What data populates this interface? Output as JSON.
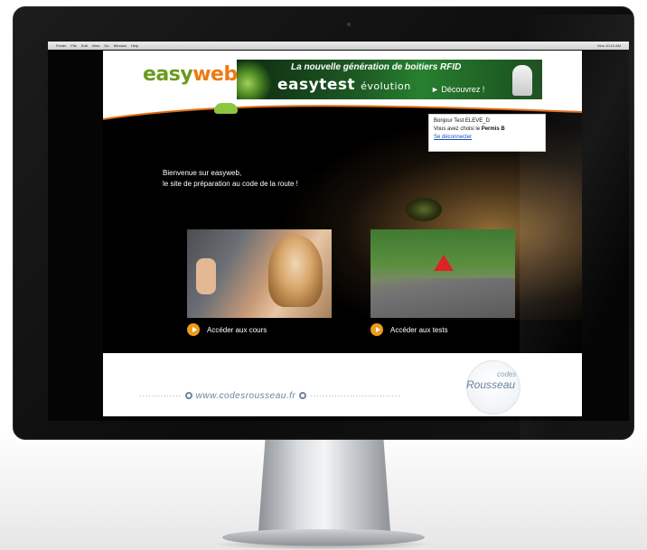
{
  "os_menubar": {
    "apple_symbol": "",
    "items": [
      "Finder",
      "File",
      "Edit",
      "View",
      "Go",
      "Window",
      "Help"
    ],
    "status": "Mon 10:10 AM"
  },
  "site": {
    "logo": {
      "part1": "easy",
      "part2": "web"
    },
    "banner": {
      "tagline": "La nouvelle génération de boitiers RFID",
      "brand": "easytest",
      "brand_sub": "évolution",
      "cta": "► Découvrez !"
    },
    "user_box": {
      "greeting": "Bonjour Test ELEVE_D",
      "choice_prefix": "Vous avez choisi le",
      "choice_value": "Permis B",
      "logout": "Se déconnecter"
    },
    "welcome": {
      "line1": "Bienvenue sur easyweb,",
      "line2": "le site de préparation au code de la route !"
    },
    "cards": [
      {
        "label": "Accéder aux cours"
      },
      {
        "label": "Accéder aux tests"
      }
    ],
    "footer": {
      "url": "www.codesrousseau.fr",
      "brand_codes": "codes",
      "brand_name": "Rousseau"
    }
  },
  "colors": {
    "logo_green": "#6a9a1f",
    "logo_orange": "#ee7a12",
    "play_orange": "#ee9a1a",
    "footer_blue": "#6b84a0"
  }
}
